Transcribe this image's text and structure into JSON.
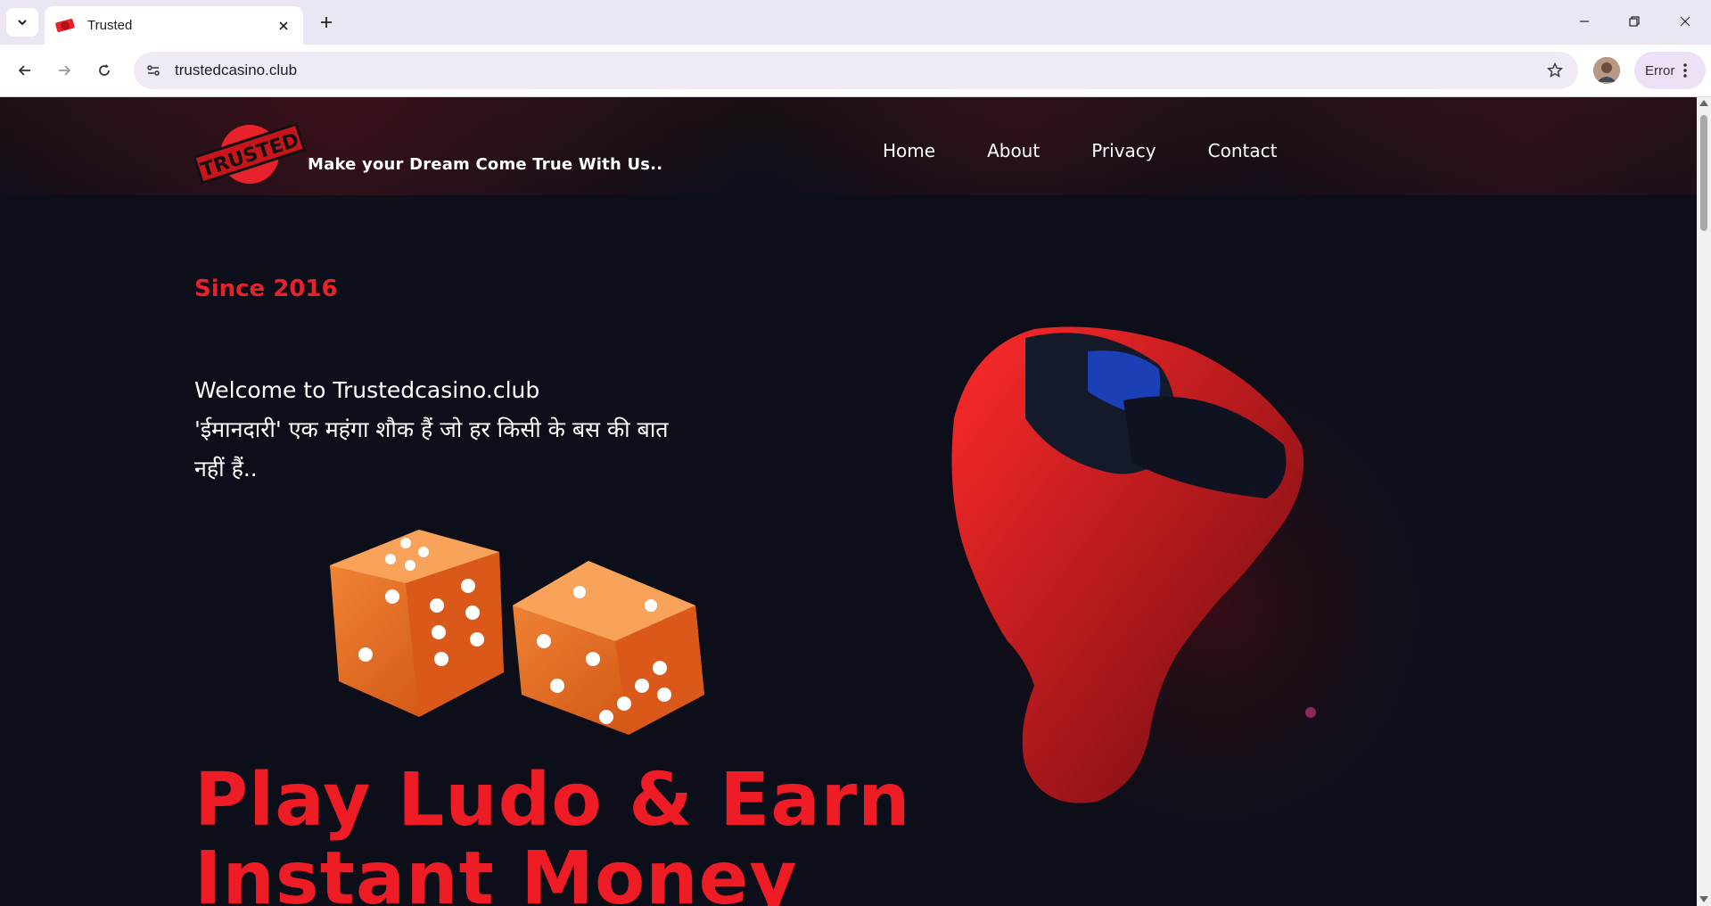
{
  "browser": {
    "tab_title": "Trusted",
    "url": "trustedcasino.club",
    "error_label": "Error"
  },
  "site": {
    "logo_text": "TRUSTED",
    "tagline": "Make your Dream Come True With Us..",
    "nav": [
      "Home",
      "About",
      "Privacy",
      "Contact"
    ],
    "since": "Since 2016",
    "welcome_line1": "Welcome to Trustedcasino.club",
    "welcome_line2": "'ईमानदारी' एक महंगा शौक हैं जो हर किसी के बस की बात नहीं हैं..",
    "headline_line1": "Play Ludo & Earn",
    "headline_line2": "Instant Money"
  },
  "colors": {
    "accent_red": "#ee1c24",
    "page_bg": "#0c0e19",
    "dice_orange": "#e8661a"
  }
}
